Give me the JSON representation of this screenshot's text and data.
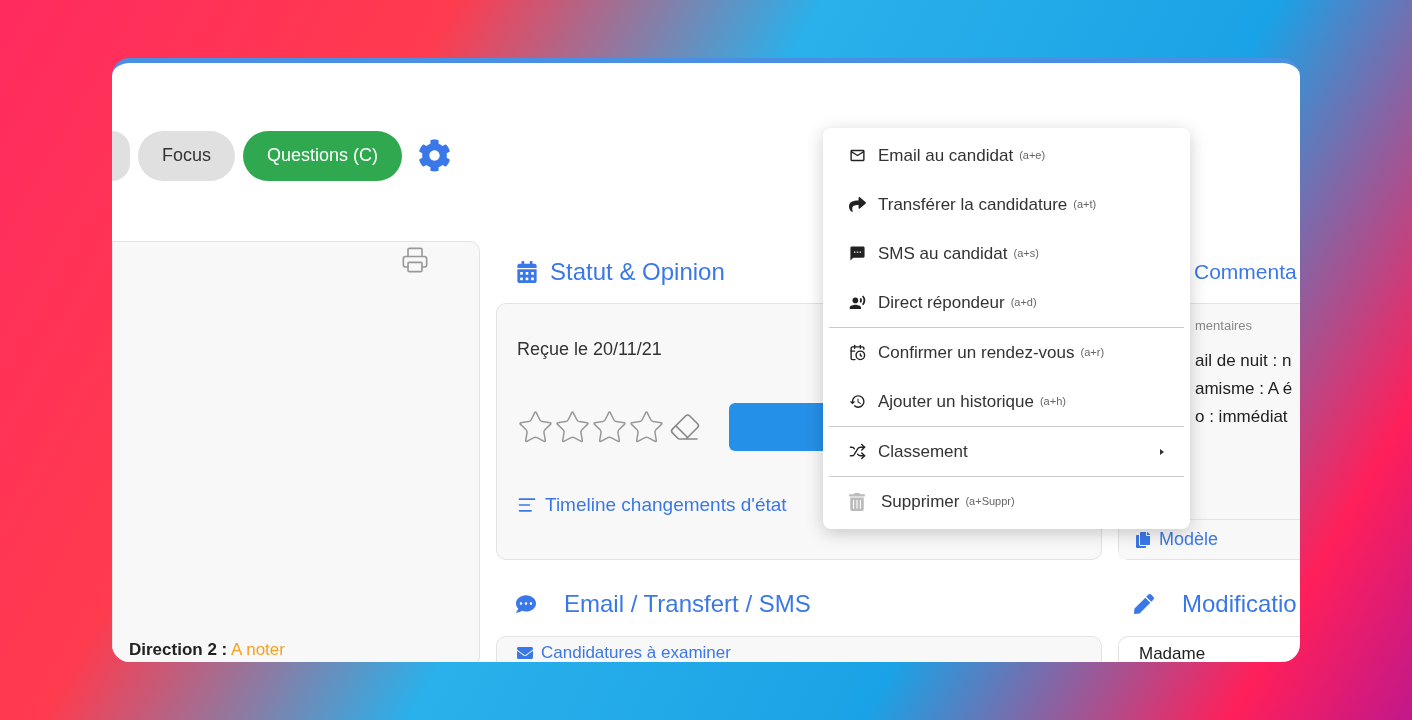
{
  "pills": [
    {
      "label": "Focus",
      "selected": false
    },
    {
      "label": "Questions (C)",
      "selected": true
    }
  ],
  "left_panel": {
    "note_label": "Direction 2 :",
    "note_value": "A noter"
  },
  "status": {
    "title": "Statut & Opinion",
    "received": "Reçue le 20/11/21",
    "stars": 0,
    "timeline_link": "Timeline changements d'état"
  },
  "messaging": {
    "title": "Email / Transfert / SMS",
    "template_select": "Candidatures à examiner"
  },
  "comments": {
    "title": "Commenta",
    "legend": "mentaires",
    "lines": [
      "ail de nuit : n",
      "amisme : A é",
      "o : immédiat"
    ],
    "template_button": "Modèle"
  },
  "edit": {
    "title": "Modificatio",
    "civility": "Madame"
  },
  "menu": {
    "groups": [
      [
        {
          "label": "Email au candidat",
          "shortcut": "(a+e)",
          "kind": "action"
        },
        {
          "label": "Transférer la candidature",
          "shortcut": "(a+t)",
          "kind": "action"
        },
        {
          "label": "SMS au candidat",
          "shortcut": "(a+s)",
          "kind": "action"
        },
        {
          "label": "Direct répondeur",
          "shortcut": "(a+d)",
          "kind": "action"
        }
      ],
      [
        {
          "label": "Confirmer un rendez-vous",
          "shortcut": "(a+r)",
          "kind": "action"
        },
        {
          "label": "Ajouter un historique",
          "shortcut": "(a+h)",
          "kind": "action"
        }
      ],
      [
        {
          "label": "Classement",
          "kind": "submenu"
        }
      ],
      [
        {
          "label": "Supprimer",
          "shortcut": "(a+Suppr)",
          "kind": "action"
        }
      ]
    ]
  }
}
